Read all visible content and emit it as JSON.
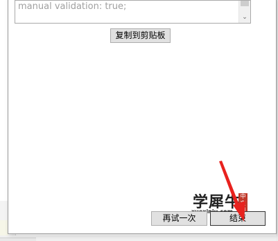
{
  "dialog": {
    "textarea": {
      "visible_text": "manual validation: true;"
    },
    "buttons": {
      "copy_label": "复制到剪贴板",
      "retry_label": "再试一次",
      "finish_label": "结束"
    }
  },
  "watermark": {
    "main_text": "学犀牛",
    "sub_text": "xuexiniu.com",
    "seal_text": "中文网"
  },
  "colors": {
    "annotation_arrow": "#e8221e",
    "seal": "#c0392b",
    "button_face": "#e1e1e1",
    "placeholder_text": "#a0a0a0"
  },
  "icons": {
    "scroll_down": "chevron-down-icon"
  }
}
